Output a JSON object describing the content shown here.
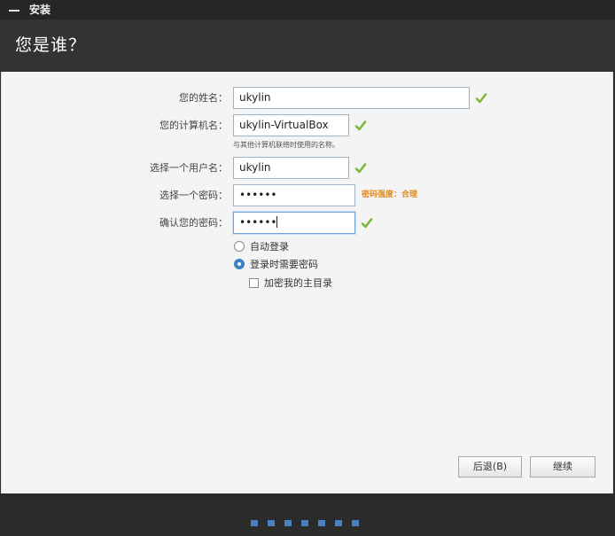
{
  "window": {
    "title": "安装"
  },
  "header": {
    "title": "您是谁？"
  },
  "form": {
    "name": {
      "label": "您的姓名：",
      "value": "ukylin"
    },
    "computer": {
      "label": "您的计算机名：",
      "value": "ukylin-VirtualBox",
      "hint": "与其他计算机联络时使用的名称。"
    },
    "username": {
      "label": "选择一个用户名：",
      "value": "ukylin"
    },
    "password": {
      "label": "选择一个密码：",
      "value": "••••••",
      "strength": "密码强度：合理"
    },
    "confirm": {
      "label": "确认您的密码：",
      "value": "••••••"
    },
    "login_options": {
      "auto": "自动登录",
      "require_password": "登录时需要密码",
      "selected": "require_password",
      "encrypt_home": "加密我的主目录",
      "encrypt_home_checked": false
    }
  },
  "buttons": {
    "back": "后退(B)",
    "continue": "继续"
  },
  "progress": {
    "current_step": 4,
    "total_steps": 7
  },
  "colors": {
    "accent": "#3f7fc4",
    "check_green": "#7cb83a",
    "strength": "#e08a1e"
  }
}
